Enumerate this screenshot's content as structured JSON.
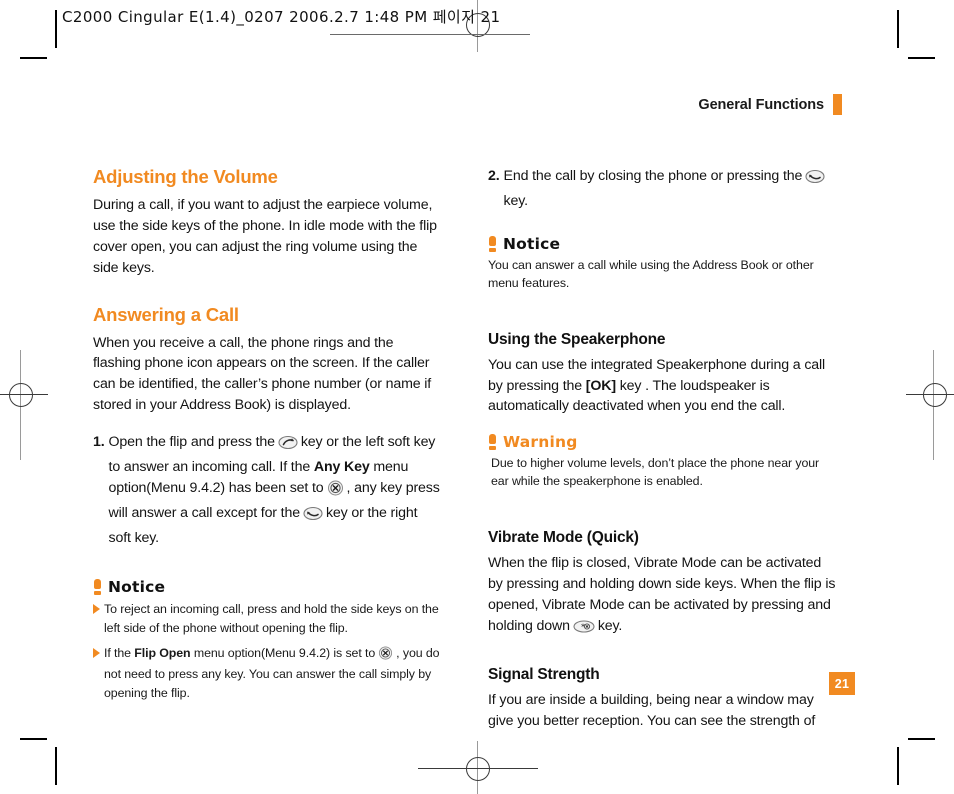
{
  "prepress": {
    "header_text": "C2000 Cingular  E(1.4)_0207  2006.2.7 1:48 PM  페이지 21"
  },
  "running_head": {
    "title": "General Functions"
  },
  "page_number": "21",
  "left_column": {
    "section1": {
      "title": "Adjusting the Volume",
      "body": "During a call, if you want to adjust the earpiece volume, use the side keys of the phone. In idle mode with the flip cover open, you can adjust the ring volume using the side keys."
    },
    "section2": {
      "title": "Answering a Call",
      "body": "When you receive a call, the phone rings and the flashing phone icon appears on the screen. If the caller can be identified, the caller’s phone number (or name if stored in your Address Book) is displayed.",
      "step1": {
        "number": "1.",
        "part1": "Open the flip and press the",
        "icon1": "send-key-icon",
        "part2": "key or the left soft key to answer an incoming call. If the",
        "bold1": "Any Key",
        "part3": "menu option(Menu 9.4.2) has been set to",
        "icon2": "x-circle-key-icon",
        "part4": ", any key press will answer a call except for the",
        "icon3": "end-key-icon",
        "part5": "key or the right soft key."
      },
      "notice": {
        "title": "Notice",
        "items": [
          {
            "text": "To reject an incoming call, press and hold the side keys on the left side of the phone without opening the flip."
          },
          {
            "part1": "If the",
            "bold1": "Flip Open",
            "part2": "menu option(Menu 9.4.2) is set to",
            "icon1": "x-circle-key-icon",
            "part3": ", you do not need to press any key. You can answer the call simply by opening the flip."
          }
        ]
      }
    }
  },
  "right_column": {
    "step2": {
      "number": "2.",
      "part1": "End the call by closing the phone or pressing the",
      "icon1": "end-key-icon",
      "part2": "key."
    },
    "notice": {
      "title": "Notice",
      "text": "You can answer a call while using the Address Book or other menu features."
    },
    "section_speakerphone": {
      "title": "Using the Speakerphone",
      "part1": "You can use the integrated Speakerphone during a call by pressing the",
      "bold1": "[OK]",
      "part2": "key . The loudspeaker is automatically deactivated when you end the call."
    },
    "warning": {
      "title": "Warning",
      "text": "Due to higher volume levels, don’t place the phone near your ear while the speakerphone is enabled."
    },
    "section_vibrate": {
      "title": "Vibrate Mode (Quick)",
      "part1": "When the flip is closed, Vibrate Mode can be activated by pressing and holding down side keys. When the flip is opened, Vibrate Mode can be activated by pressing and holding down",
      "icon1": "star-key-icon",
      "part2": "key."
    },
    "section_signal": {
      "title": "Signal Strength",
      "body": "If you are inside a building, being near a window may give you better reception. You can see the strength of"
    }
  },
  "colors": {
    "accent_orange": "#f18a21",
    "text_black": "#141414"
  }
}
